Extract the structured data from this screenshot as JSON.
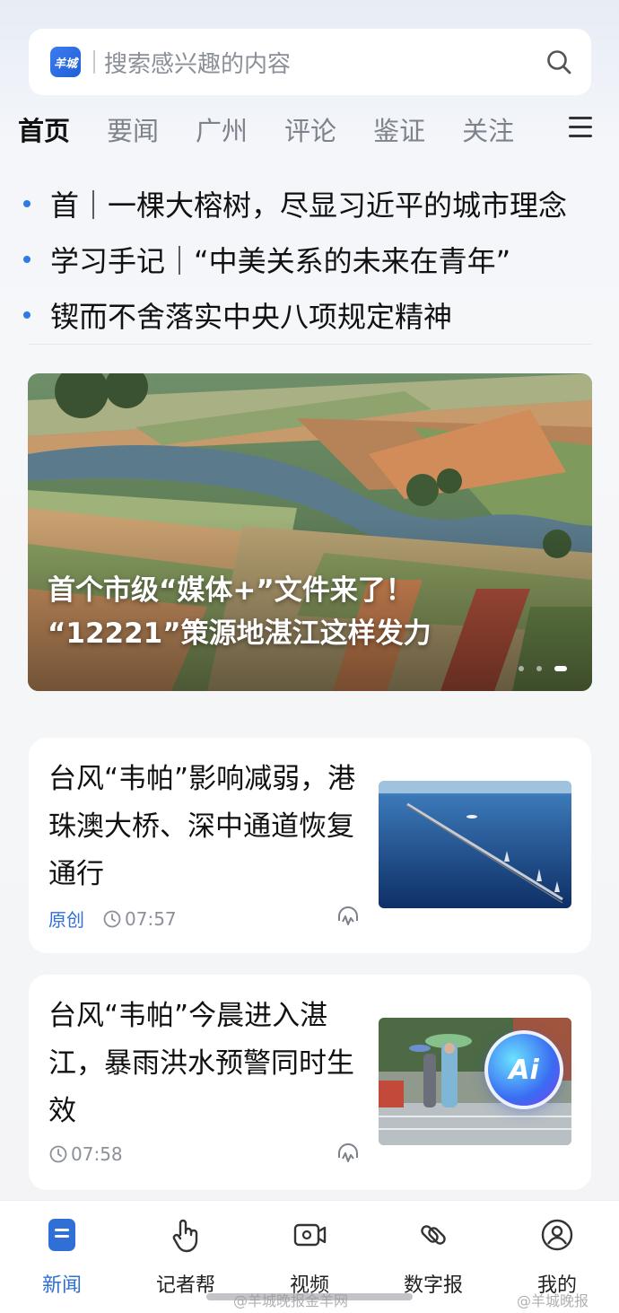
{
  "search": {
    "logo_text": "羊城",
    "placeholder": "搜索感兴趣的内容"
  },
  "tabs": [
    {
      "label": "首页",
      "active": true
    },
    {
      "label": "要闻"
    },
    {
      "label": "广州"
    },
    {
      "label": "评论"
    },
    {
      "label": "鉴证"
    },
    {
      "label": "关注"
    }
  ],
  "headlines": [
    "首｜一棵大榕树，尽显习近平的城市理念",
    "学习手记｜“中美关系的未来在青年”",
    "锲而不舍落实中央八项规定精神"
  ],
  "banner": {
    "line1": "首个市级“媒体+”文件来了！",
    "line2": "“12221”策源地湛江这样发力",
    "slide_index": 3,
    "slide_count": 3
  },
  "articles": [
    {
      "title": "台风“韦帕”影响减弱，港珠澳大桥、深中通道恢复通行",
      "tag": "原创",
      "time": "07:57",
      "thumb_icon": "bridge-over-sea-photo"
    },
    {
      "title": "台风“韦帕”今晨进入湛江，暴雨洪水预警同时生效",
      "tag": "",
      "time": "07:58",
      "thumb_icon": "rainy-street-photo",
      "badge": "Ai"
    }
  ],
  "bottom_nav": [
    {
      "label": "新闻",
      "icon": "news-icon",
      "active": true
    },
    {
      "label": "记者帮",
      "icon": "hand-icon"
    },
    {
      "label": "视频",
      "icon": "video-icon"
    },
    {
      "label": "数字报",
      "icon": "link-icon"
    },
    {
      "label": "我的",
      "icon": "profile-icon"
    }
  ],
  "watermarks": [
    "@羊城晚报金羊网",
    "@羊城晚报"
  ],
  "colors": {
    "accent": "#2f6fd6",
    "bullet": "#2f7be5"
  }
}
